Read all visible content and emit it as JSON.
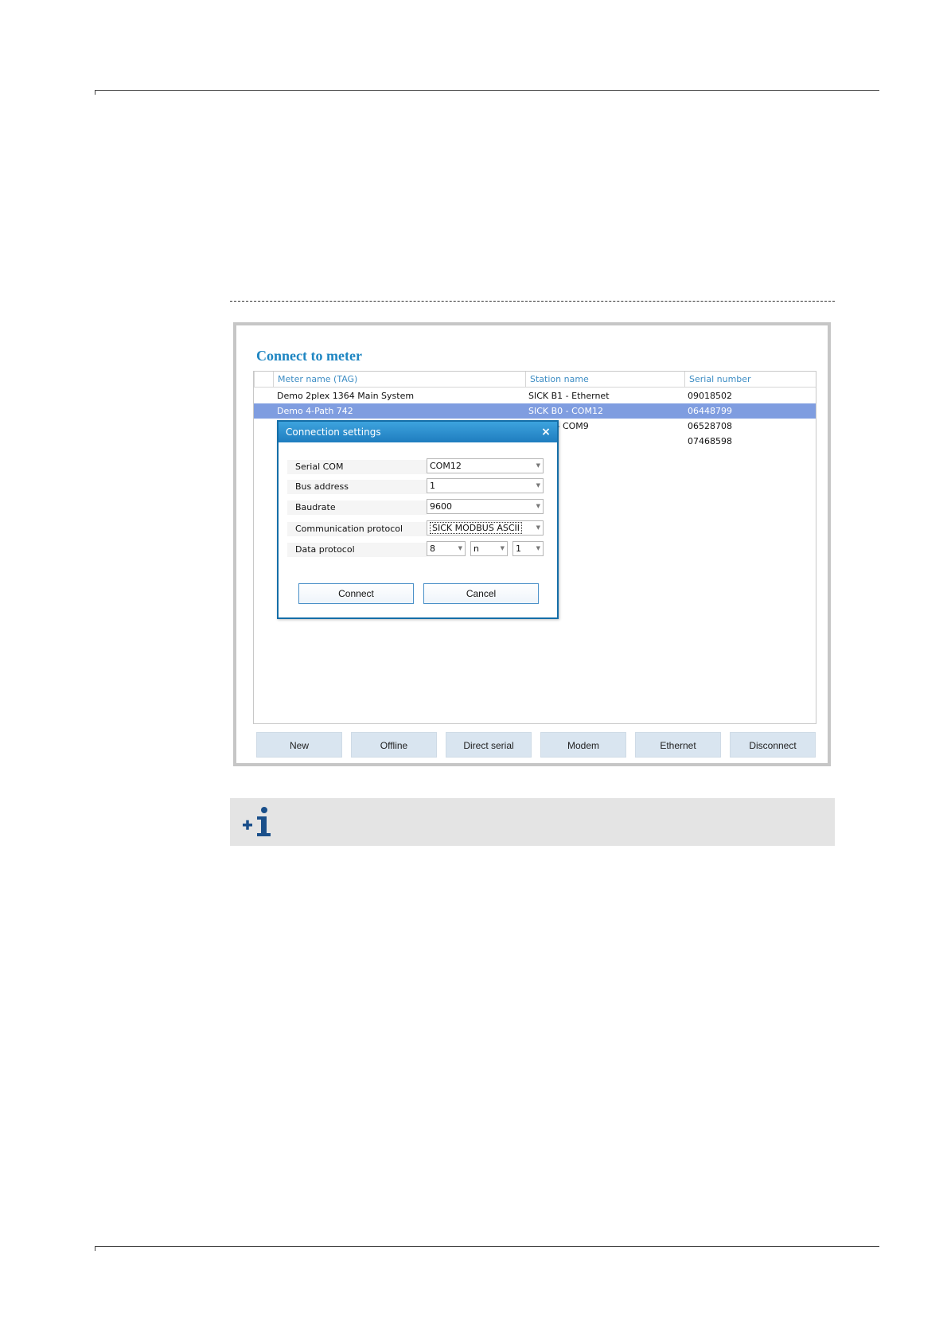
{
  "window": {
    "title": "Connect to meter"
  },
  "table": {
    "columns": [
      "Meter name (TAG)",
      "Station name",
      "Serial number"
    ],
    "rows": [
      {
        "meter": "Demo 2plex 1364 Main System",
        "station": "SICK B1 - Ethernet",
        "serial": "09018502",
        "selected": false
      },
      {
        "meter": "Demo 4-Path 742",
        "station": "SICK B0 - COM12",
        "serial": "06448799",
        "selected": true
      },
      {
        "meter": "",
        "station": "0 - COM9",
        "serial": "06528708",
        "selected": false
      },
      {
        "meter": "",
        "station": "",
        "serial": "07468598",
        "selected": false
      }
    ]
  },
  "dialog": {
    "title": "Connection settings",
    "close_glyph": "×",
    "fields": {
      "serial_com": {
        "label": "Serial COM",
        "value": "COM12"
      },
      "bus_address": {
        "label": "Bus address",
        "value": "1"
      },
      "baudrate": {
        "label": "Baudrate",
        "value": "9600"
      },
      "communication_protocol": {
        "label": "Communication protocol",
        "value": "SICK MODBUS ASCII"
      },
      "data_protocol": {
        "label": "Data protocol",
        "data_bits": "8",
        "parity": "n",
        "stop_bits": "1"
      }
    },
    "connect_label": "Connect",
    "cancel_label": "Cancel"
  },
  "toolbar": {
    "new_label": "New",
    "offline_label": "Offline",
    "direct_serial_label": "Direct serial",
    "modem_label": "Modem",
    "ethernet_label": "Ethernet",
    "disconnect_label": "Disconnect"
  },
  "colors": {
    "accent": "#1f86c2",
    "selection": "#7f9de0",
    "dialog_border": "#146ea8",
    "info_icon": "#1a4f8a"
  },
  "icons": {
    "note": "info-plus-icon",
    "dropdown": "chevron-down-icon",
    "close": "close-icon"
  }
}
